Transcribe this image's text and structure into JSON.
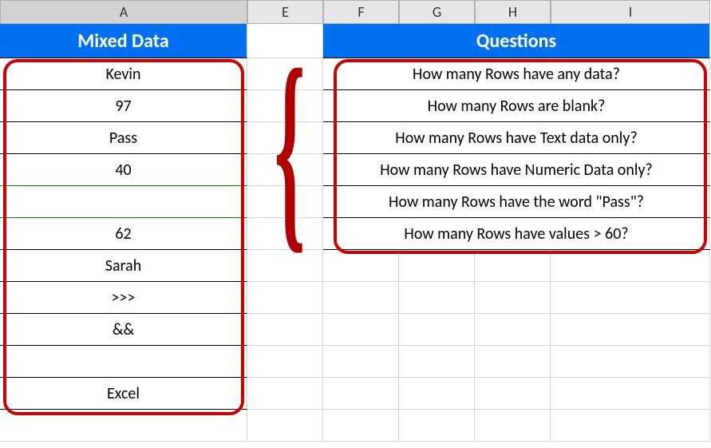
{
  "column_headers": [
    "A",
    "E",
    "F",
    "G",
    "H",
    "I"
  ],
  "mixed_data": {
    "title": "Mixed Data",
    "rows": [
      "Kevin",
      "97",
      "Pass",
      "40",
      "",
      "62",
      "Sarah",
      ">>>",
      "&&",
      "",
      "Excel"
    ]
  },
  "questions": {
    "title": "Questions",
    "rows": [
      "How many Rows have any data?",
      "How many Rows are blank?",
      "How many Rows have Text data only?",
      "How many Rows have Numeric Data only?",
      "How many Rows have the word \"Pass\"?",
      "How many Rows have values > 60?"
    ]
  }
}
